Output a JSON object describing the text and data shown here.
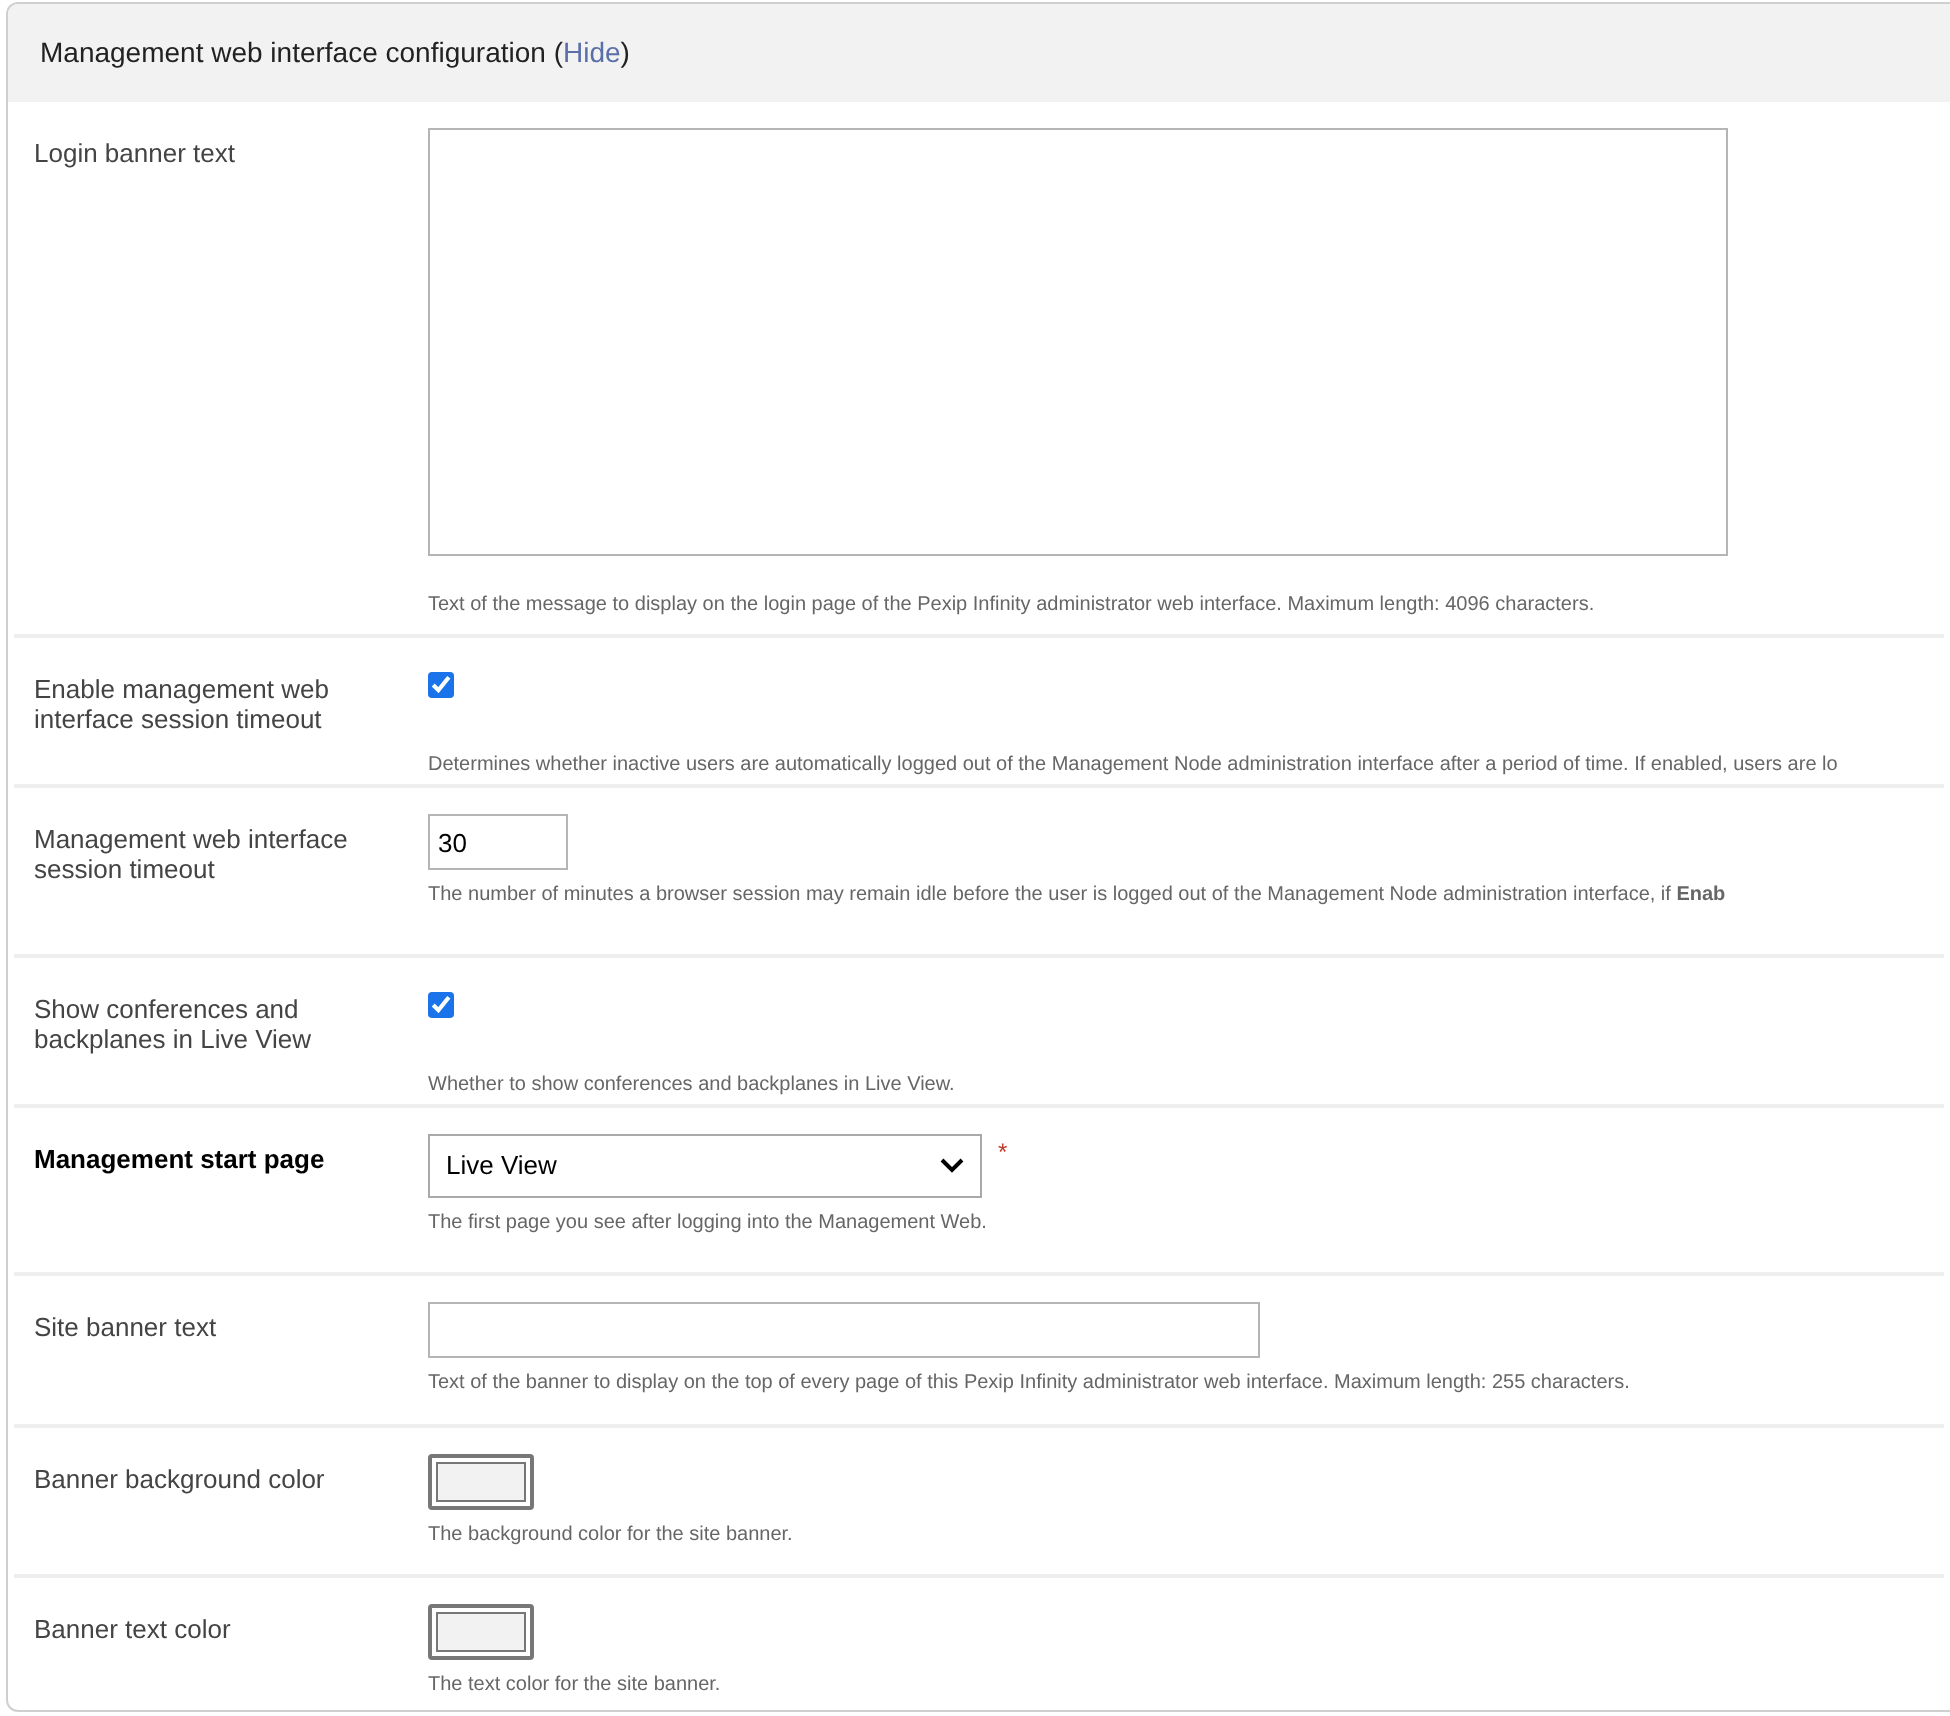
{
  "section": {
    "title": "Management web interface configuration (",
    "toggle_link": "Hide",
    "title_end": ")"
  },
  "fields": [
    {
      "kind": "textarea",
      "label": "Login banner text",
      "required": false,
      "help": "Text of the message to display on the login page of the Pexip Infinity administrator web interface. Maximum length: 4096 characters."
    },
    {
      "kind": "checkbox",
      "label": "Enable management web interface session timeout",
      "required": false,
      "checked": true,
      "help": "Determines whether inactive users are automatically logged out of the Management Node administration interface after a period of time. If enabled, users are lo"
    },
    {
      "kind": "number",
      "label": "Management web interface session timeout",
      "required": false,
      "value": "30",
      "help": "The number of minutes a browser session may remain idle before the user is logged out of the Management Node administration interface, if **Enab**"
    },
    {
      "kind": "checkbox",
      "label": "Show conferences and backplanes in Live View",
      "required": false,
      "checked": true,
      "help": "Whether to show conferences and backplanes in Live View."
    },
    {
      "kind": "select",
      "label": "Management start page",
      "required": true,
      "required_mark": "*",
      "value": "Live View",
      "help": "The first page you see after logging into the Management Web."
    },
    {
      "kind": "text",
      "label": "Site banner text",
      "required": false,
      "help": "Text of the banner to display on the top of every page of this Pexip Infinity administrator web interface. Maximum length: 255 characters."
    },
    {
      "kind": "color",
      "label": "Banner background color",
      "required": false,
      "color": "#f2f2f2",
      "help": "The background color for the site banner."
    },
    {
      "kind": "color",
      "label": "Banner text color",
      "required": false,
      "color": "#f2f2f2",
      "help": "The text color for the site banner."
    }
  ]
}
